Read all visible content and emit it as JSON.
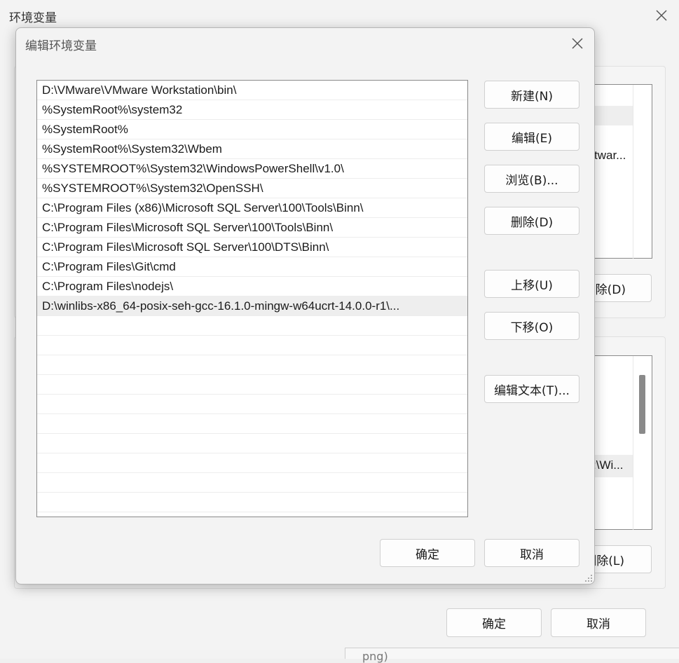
{
  "parent_window": {
    "title": "环境变量",
    "user_vars_peek_text": "twar...",
    "user_delete_label": "除(D)",
    "system_vars_peek_text": ":\\Wi...",
    "system_delete_label": "删除(L)",
    "ok_label": "确定",
    "cancel_label": "取消",
    "bottom_peek_text": "png)"
  },
  "dialog": {
    "title": "编辑环境变量",
    "entries": [
      "D:\\VMware\\VMware Workstation\\bin\\",
      "%SystemRoot%\\system32",
      "%SystemRoot%",
      "%SystemRoot%\\System32\\Wbem",
      "%SYSTEMROOT%\\System32\\WindowsPowerShell\\v1.0\\",
      "%SYSTEMROOT%\\System32\\OpenSSH\\",
      "C:\\Program Files (x86)\\Microsoft SQL Server\\100\\Tools\\Binn\\",
      "C:\\Program Files\\Microsoft SQL Server\\100\\Tools\\Binn\\",
      "C:\\Program Files\\Microsoft SQL Server\\100\\DTS\\Binn\\",
      "C:\\Program Files\\Git\\cmd",
      "C:\\Program Files\\nodejs\\",
      "D:\\winlibs-x86_64-posix-seh-gcc-16.1.0-mingw-w64ucrt-14.0.0-r1\\...",
      "",
      "",
      "",
      "",
      "",
      "",
      "",
      "",
      "",
      ""
    ],
    "buttons": {
      "new": "新建(N)",
      "edit": "编辑(E)",
      "browse": "浏览(B)...",
      "delete": "删除(D)",
      "move_up": "上移(U)",
      "move_down": "下移(O)",
      "edit_text": "编辑文本(T)..."
    },
    "ok_label": "确定",
    "cancel_label": "取消"
  }
}
